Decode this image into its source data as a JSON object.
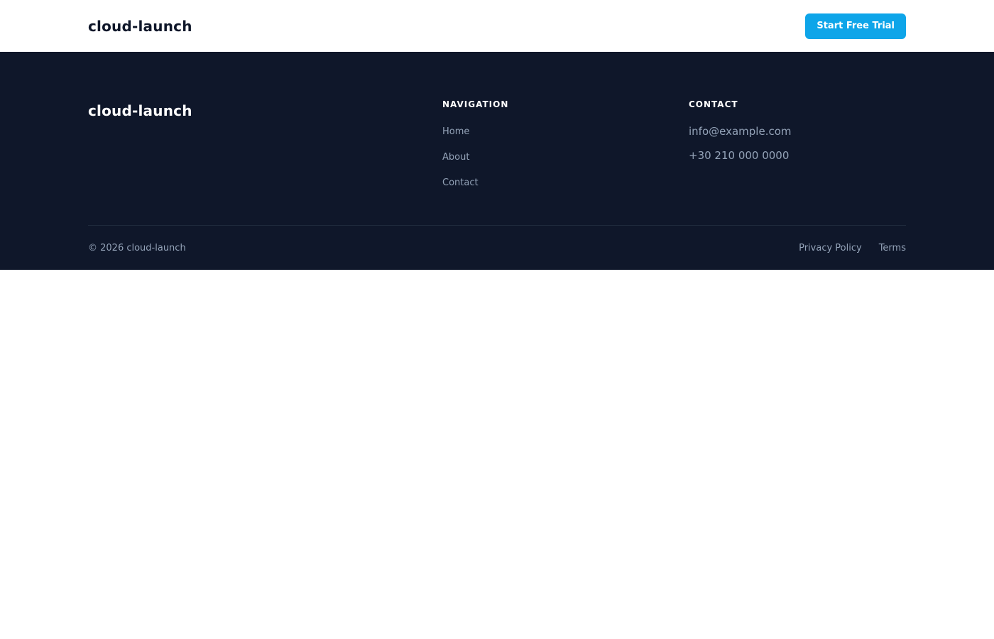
{
  "header": {
    "logo": "cloud-launch",
    "cta_label": "Start Free Trial"
  },
  "footer": {
    "logo": "cloud-launch",
    "navigation": {
      "heading": "NAVIGATION",
      "links": [
        "Home",
        "About",
        "Contact"
      ]
    },
    "contact": {
      "heading": "CONTACT",
      "email": "info@example.com",
      "phone": "+30 210 000 0000"
    },
    "copyright": "© 2026 cloud-launch",
    "legal": [
      "Privacy Policy",
      "Terms"
    ]
  },
  "colors": {
    "accent": "#0ea5e9",
    "footer_bg": "#0f172a",
    "muted_text": "#94a3b8"
  }
}
